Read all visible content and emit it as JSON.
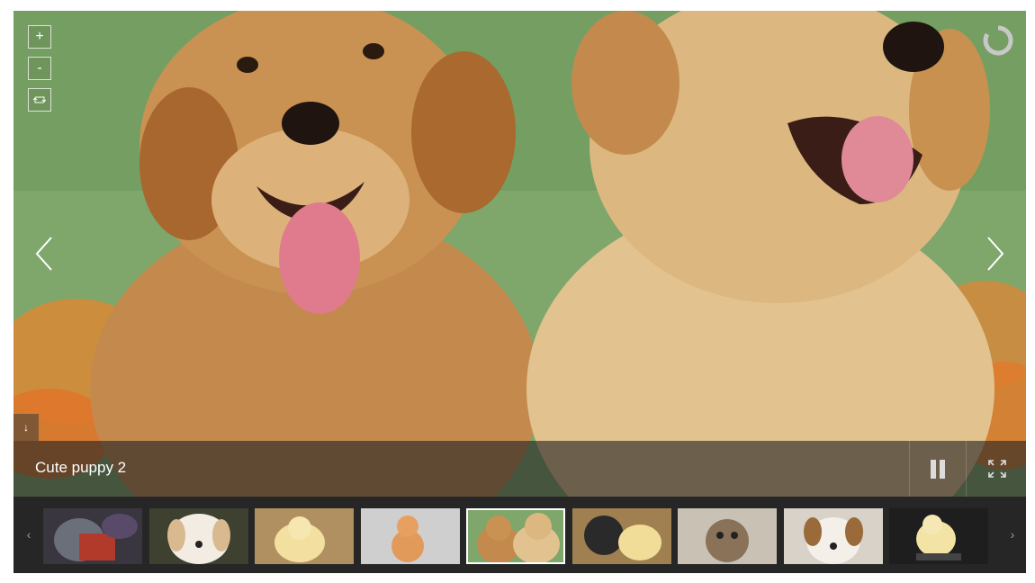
{
  "gallery": {
    "caption": "Cute puppy 2",
    "controls": {
      "zoom_in": "+",
      "zoom_out": "-",
      "strip_toggle": "↓",
      "thumb_prev": "‹",
      "thumb_next": "›"
    },
    "icons": {
      "zoom_reset": "reset-icon",
      "loader": "loading-spinner-icon",
      "prev": "chevron-left-icon",
      "next": "chevron-right-icon",
      "pause": "pause-icon",
      "fullscreen": "fullscreen-icon"
    },
    "colors": {
      "frame": "#1e1e1e",
      "caption_bar": "#232323",
      "thumbstrip": "#262626",
      "active_border": "#ffffff"
    },
    "thumbnails": [
      {
        "subject": "cat in costume",
        "active": false
      },
      {
        "subject": "white puppy",
        "active": false
      },
      {
        "subject": "yellow chick",
        "active": false
      },
      {
        "subject": "orange kitten",
        "active": false
      },
      {
        "subject": "two golden puppies",
        "active": true
      },
      {
        "subject": "chicks",
        "active": false
      },
      {
        "subject": "tabby kitten",
        "active": false
      },
      {
        "subject": "brown and white puppy",
        "active": false
      },
      {
        "subject": "chick on dark background",
        "active": false
      }
    ]
  }
}
